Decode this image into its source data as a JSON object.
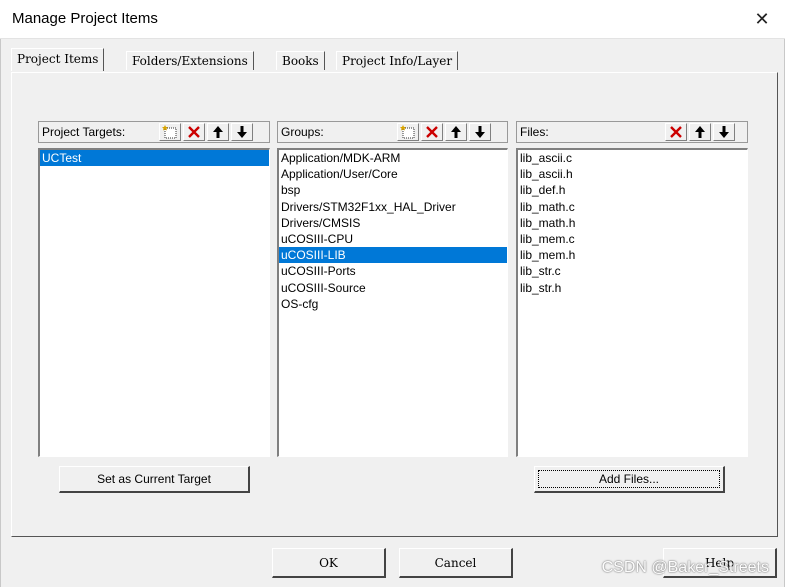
{
  "window": {
    "title": "Manage Project Items",
    "close_glyph": "✕"
  },
  "tabs": [
    {
      "label": "Project Items",
      "active": true
    },
    {
      "label": "Folders/Extensions",
      "active": false
    },
    {
      "label": "Books",
      "active": false
    },
    {
      "label": "Project Info/Layer",
      "active": false
    }
  ],
  "targets": {
    "label": "Project Targets:",
    "items": [
      "UCTest"
    ],
    "selected": "UCTest"
  },
  "groups": {
    "label": "Groups:",
    "items": [
      "Application/MDK-ARM",
      "Application/User/Core",
      "bsp",
      "Drivers/STM32F1xx_HAL_Driver",
      "Drivers/CMSIS",
      "uCOSIII-CPU",
      "uCOSIII-LIB",
      "uCOSIII-Ports",
      "uCOSIII-Source",
      "OS-cfg"
    ],
    "selected": "uCOSIII-LIB"
  },
  "files": {
    "label": "Files:",
    "items": [
      "lib_ascii.c",
      "lib_ascii.h",
      "lib_def.h",
      "lib_math.c",
      "lib_math.h",
      "lib_mem.c",
      "lib_mem.h",
      "lib_str.c",
      "lib_str.h"
    ]
  },
  "buttons": {
    "set_current": "Set as Current Target",
    "add_files": "Add Files...",
    "ok": "OK",
    "cancel": "Cancel",
    "help": "Help"
  },
  "watermark": "CSDN @Baker_Streets",
  "colors": {
    "selection": "#0078d7",
    "delete_icon": "#cc0000",
    "new_icon_star": "#d9a400"
  }
}
